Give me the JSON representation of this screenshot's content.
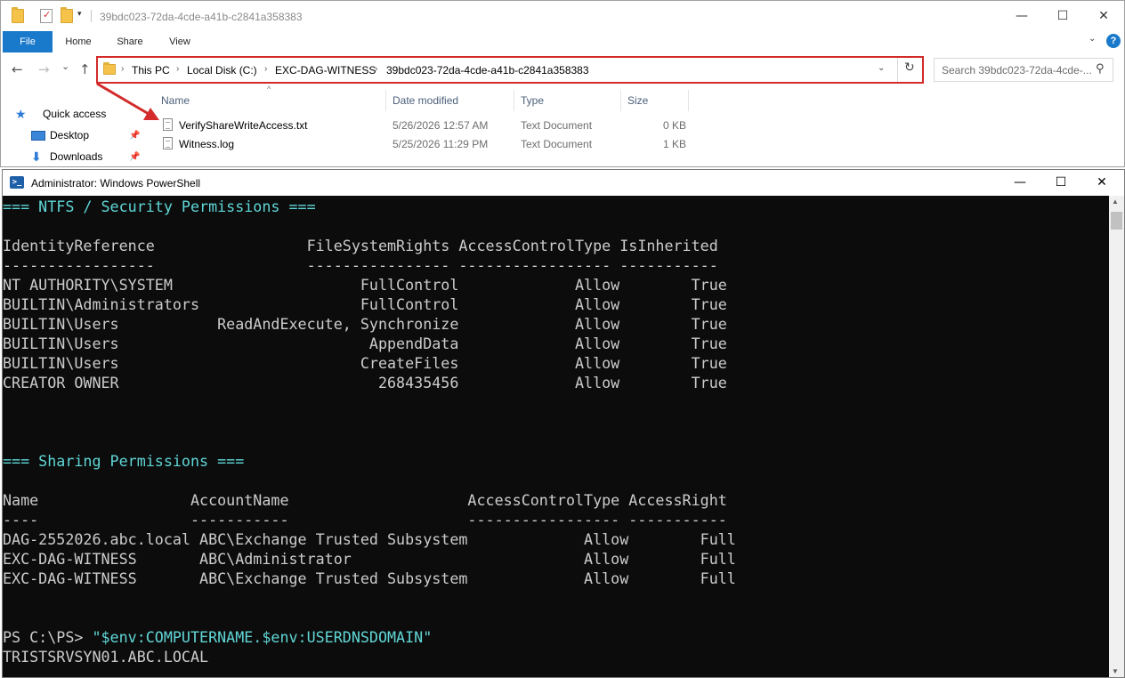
{
  "explorer": {
    "title": "39bdc023-72da-4cde-a41b-c2841a358383",
    "quick_access_dropdown": "▾",
    "controls": {
      "minimize": "—",
      "maximize": "☐",
      "close": "✕"
    },
    "ribbon": {
      "tabs": [
        {
          "label": "File"
        },
        {
          "label": "Home"
        },
        {
          "label": "Share"
        },
        {
          "label": "View"
        }
      ],
      "help": "?"
    },
    "nav_buttons": {
      "back": "←",
      "forward": "→",
      "recent": "⌄",
      "up": "↑"
    },
    "address": {
      "crumbs": [
        "This PC",
        "Local Disk (C:)",
        "EXC-DAG-WITNESS",
        "39bdc023-72da-4cde-a41b-c2841a358383"
      ],
      "separator": "›",
      "highlight_color": "#d32b2b"
    },
    "search": {
      "placeholder": "Search 39bdc023-72da-4cde-..."
    },
    "nav_pane": [
      {
        "label": "Quick access",
        "icon": "star-icon"
      },
      {
        "label": "Desktop",
        "icon": "desktop-icon",
        "pinned": true
      },
      {
        "label": "Downloads",
        "icon": "download-icon",
        "pinned": true
      }
    ],
    "columns": [
      "Name",
      "Date modified",
      "Type",
      "Size"
    ],
    "files": [
      {
        "name": "VerifyShareWriteAccess.txt",
        "date": "5/26/2026 12:57 AM",
        "type": "Text Document",
        "size": "0 KB"
      },
      {
        "name": "Witness.log",
        "date": "5/25/2026 11:29 PM",
        "type": "Text Document",
        "size": "1 KB"
      }
    ]
  },
  "powershell": {
    "title": "Administrator: Windows PowerShell",
    "icon": "powershell-icon",
    "controls": {
      "minimize": "—",
      "maximize": "☐",
      "close": "✕"
    },
    "lines": [
      {
        "text": "=== NTFS / Security Permissions ===",
        "style": "cyan"
      },
      {
        "text": "",
        "style": "plain"
      },
      {
        "text": "IdentityReference                 FileSystemRights AccessControlType IsInherited",
        "style": "plain"
      },
      {
        "text": "-----------------                 ---------------- ----------------- -----------",
        "style": "plain"
      },
      {
        "text": "NT AUTHORITY\\SYSTEM                     FullControl             Allow        True",
        "style": "plain"
      },
      {
        "text": "BUILTIN\\Administrators                  FullControl             Allow        True",
        "style": "plain"
      },
      {
        "text": "BUILTIN\\Users           ReadAndExecute, Synchronize             Allow        True",
        "style": "plain"
      },
      {
        "text": "BUILTIN\\Users                            AppendData             Allow        True",
        "style": "plain"
      },
      {
        "text": "BUILTIN\\Users                           CreateFiles             Allow        True",
        "style": "plain"
      },
      {
        "text": "CREATOR OWNER                             268435456             Allow        True",
        "style": "plain"
      },
      {
        "text": "",
        "style": "plain"
      },
      {
        "text": "",
        "style": "plain"
      },
      {
        "text": "",
        "style": "plain"
      },
      {
        "text": "=== Sharing Permissions ===",
        "style": "cyan"
      },
      {
        "text": "",
        "style": "plain"
      },
      {
        "text": "Name                 AccountName                    AccessControlType AccessRight",
        "style": "plain"
      },
      {
        "text": "----                 -----------                    ----------------- -----------",
        "style": "plain"
      },
      {
        "text": "DAG-2552026.abc.local ABC\\Exchange Trusted Subsystem             Allow        Full",
        "style": "plain"
      },
      {
        "text": "EXC-DAG-WITNESS       ABC\\Administrator                          Allow        Full",
        "style": "plain"
      },
      {
        "text": "EXC-DAG-WITNESS       ABC\\Exchange Trusted Subsystem             Allow        Full",
        "style": "plain"
      },
      {
        "text": "",
        "style": "plain"
      },
      {
        "text": "",
        "style": "plain"
      },
      {
        "text": "",
        "style": "plain"
      }
    ],
    "prompt": {
      "prefix": "PS C:\\PS> ",
      "command": "\"$env:COMPUTERNAME.$env:USERDNSDOMAIN\""
    },
    "output": "TRISTSRVSYN01.ABC.LOCAL",
    "colors": {
      "background": "#0c0c0c",
      "text": "#cccccc",
      "heading": "#5fd7d7"
    }
  }
}
